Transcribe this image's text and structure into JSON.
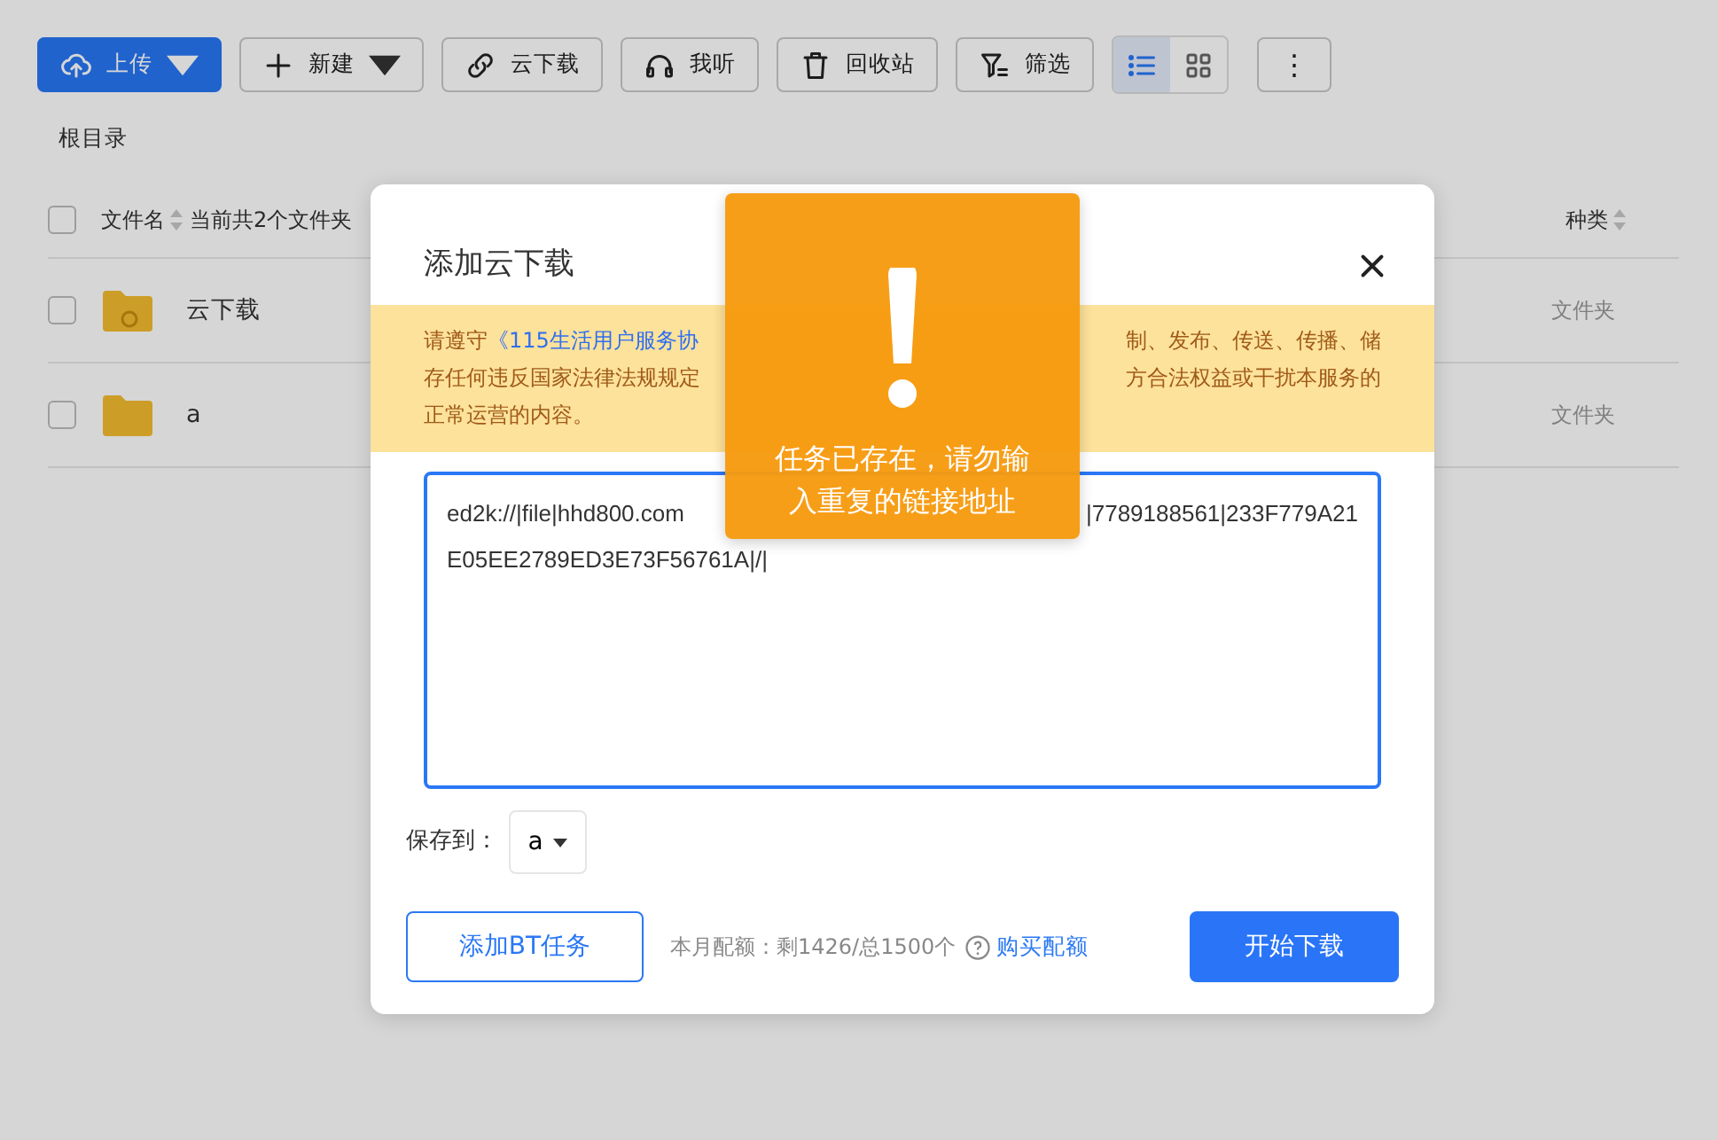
{
  "toolbar": {
    "buttons": [
      {
        "label": "上传",
        "kind": "primary",
        "caret": true
      },
      {
        "label": "新建",
        "kind": "default",
        "caret": true
      },
      {
        "label": "云下载",
        "kind": "default",
        "caret": false
      },
      {
        "label": "我听",
        "kind": "default",
        "caret": false
      },
      {
        "label": "回收站",
        "kind": "default",
        "caret": false
      },
      {
        "label": "筛选",
        "kind": "default",
        "caret": false
      }
    ],
    "view_modes": [
      {
        "selected": true
      },
      {
        "selected": false
      }
    ],
    "more": "⋮"
  },
  "breadcrumb": "根目录",
  "table": {
    "select_all_checked": false,
    "columns": [
      {
        "label": "文件名",
        "sortable": true
      },
      {
        "label": "当前共2个文件夹",
        "sortable": false
      },
      {
        "label": "种类",
        "sortable": true
      }
    ],
    "rows": [
      {
        "name": "云下载",
        "type": "文件夹",
        "checked": false
      },
      {
        "name": "a",
        "type": "文件夹",
        "checked": false
      }
    ]
  },
  "dialog": {
    "title": "添加云下载",
    "notice_lines": [
      [
        [
          {
            "kind": "text",
            "text": "请遵守"
          },
          {
            "kind": "link",
            "text": "《115生活用户服务协"
          }
        ],
        [
          {
            "kind": "text",
            "text": "制、发布、传送、传播、储"
          }
        ]
      ],
      [
        [
          {
            "kind": "text",
            "text": "存任何违反国家法律法规规定"
          }
        ],
        [
          {
            "kind": "text",
            "text": "方合法权益或干扰本服务的"
          }
        ]
      ],
      [
        [
          {
            "kind": "text",
            "text": "正常运营的内容。"
          }
        ]
      ]
    ],
    "link_lines": [
      [
        "ed2k://|file|hhd800.com",
        "|7789188561|233F779A21"
      ],
      [
        "E05EE2789ED3E73F56761A|/|"
      ]
    ],
    "save_label": "保存到：",
    "save_folder": "a",
    "bt_button": "添加BT任务",
    "quota": "本月配额：剩1426/总1500个",
    "buy_link": "购买配额",
    "start_button": "开始下载"
  },
  "toast": {
    "message": "任务已存在，请勿输入重复的链接地址"
  }
}
